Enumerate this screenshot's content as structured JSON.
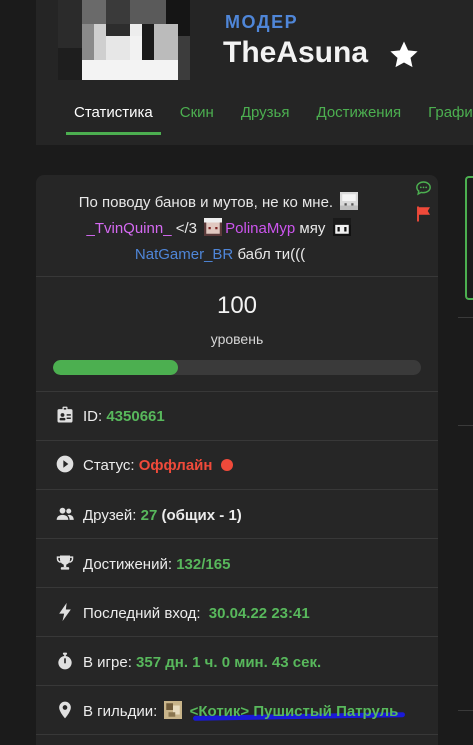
{
  "profile": {
    "role": "МОДЕР",
    "nickname": "TheAsuna"
  },
  "tabs": [
    {
      "label": "Статистика",
      "active": true
    },
    {
      "label": "Скин",
      "active": false
    },
    {
      "label": "Друзья",
      "active": false
    },
    {
      "label": "Достижения",
      "active": false
    },
    {
      "label": "Графики",
      "active": false
    }
  ],
  "status_message": {
    "text1": "По поводу банов и мутов, не ко мне.",
    "user1": "_TvinQuinn_",
    "text2": "</3",
    "user2": "PolinaMyp",
    "text3": "мяу",
    "user3": "NatGamer_BR",
    "text4": "бабл ти((("
  },
  "level": {
    "value": "100",
    "label": "уровень",
    "progress": 0.34
  },
  "stats": {
    "id_label": "ID:",
    "id_value": "4350661",
    "status_label": "Статус:",
    "status_value": "Оффлайн",
    "friends_label": "Друзей:",
    "friends_value": "27",
    "friends_common": "(общих - 1)",
    "achievements_label": "Достижений:",
    "achievements_value": "132/165",
    "last_login_label": "Последний вход:",
    "last_login_value": "30.04.22 23:41",
    "playtime_label": "В игре:",
    "playtime_value": "357 дн. 1 ч. 0 мин. 43 сек.",
    "guild_label": "В гильдии:",
    "guild_value": "<Котик> Пушистый Патруль"
  },
  "colors": {
    "accent_green": "#4caf50",
    "role_blue": "#4f86d8",
    "offline_red": "#f04a3a",
    "annotation_underline": "#1a1ad8"
  },
  "icons": [
    "star-icon",
    "comment-icon",
    "flag-icon",
    "id-card-icon",
    "play-circle-icon",
    "users-icon",
    "trophy-icon",
    "lightning-icon",
    "stopwatch-icon",
    "location-pin-icon"
  ]
}
